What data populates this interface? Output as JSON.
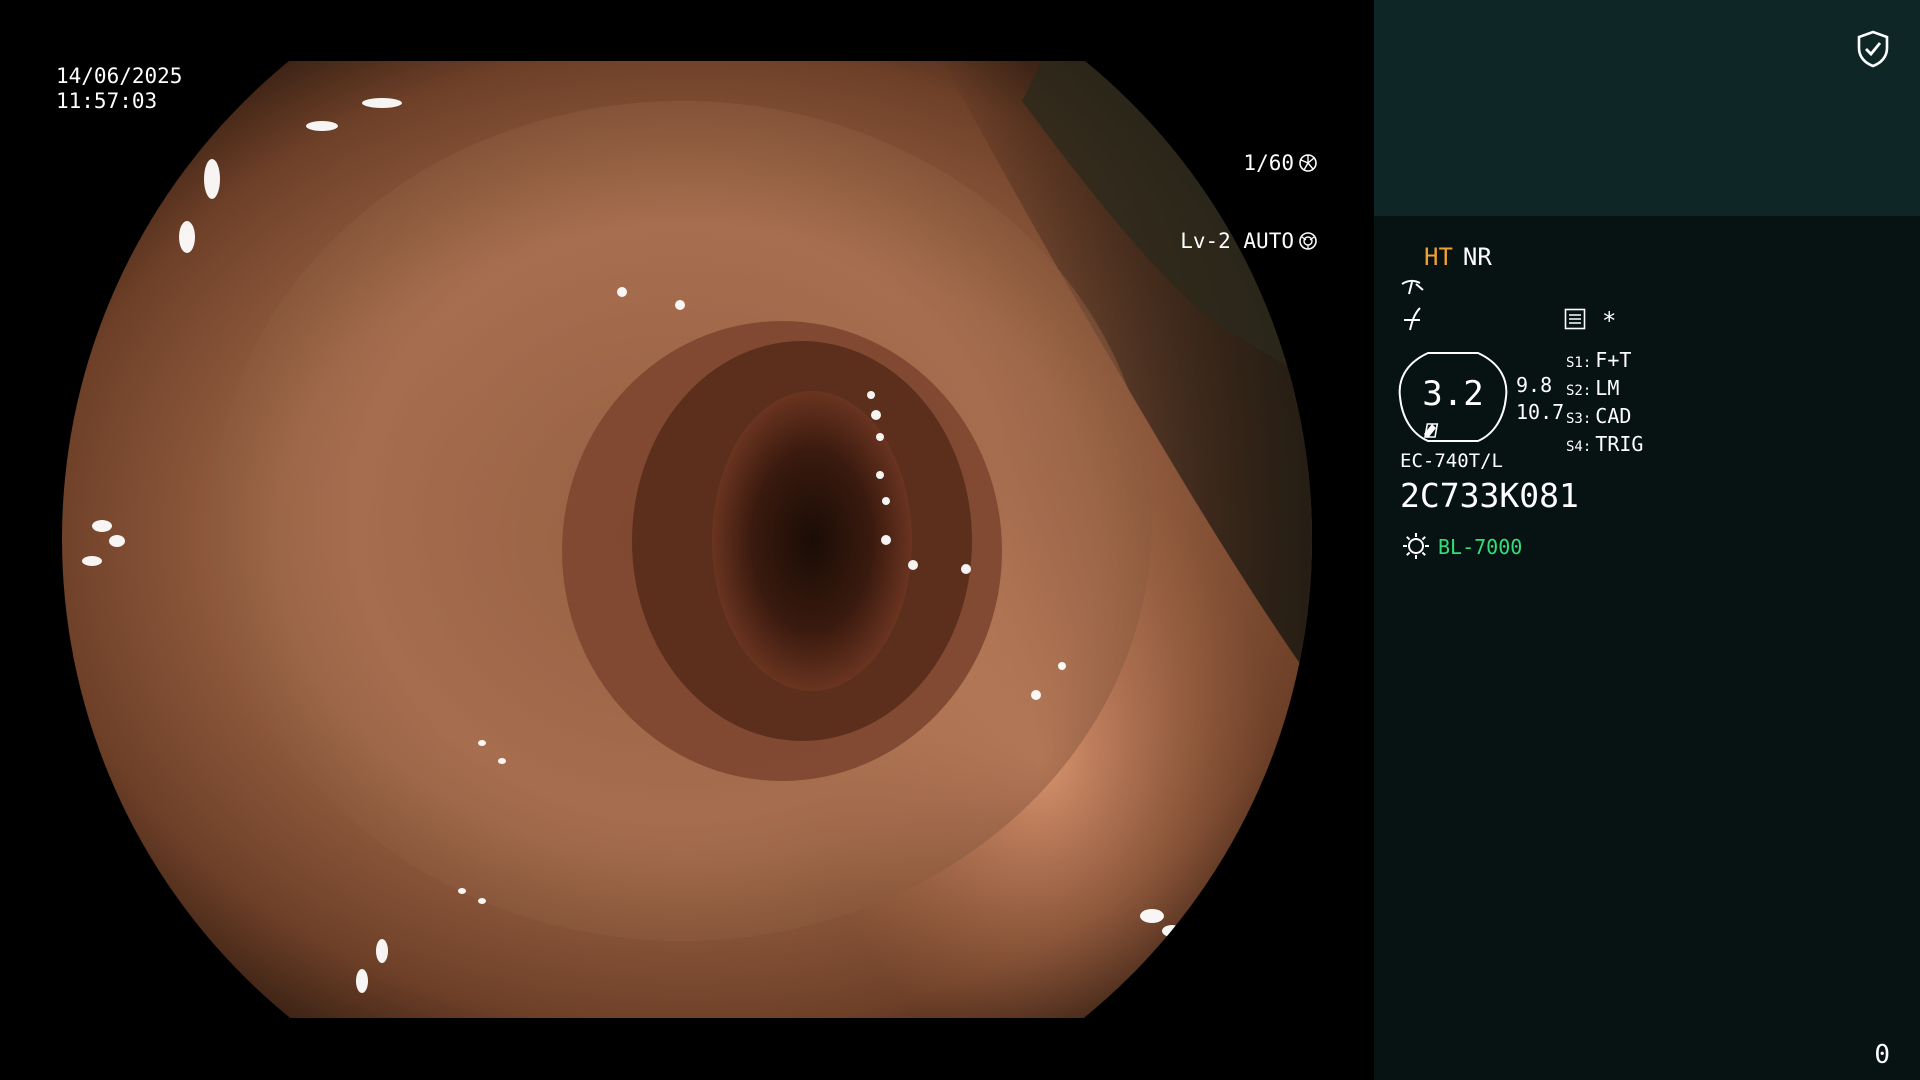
{
  "overlay": {
    "date": "14/06/2025",
    "time": "11:57:03",
    "shutter": "1/60",
    "level_mode": "Lv-2 AUTO"
  },
  "panel": {
    "mode_ht": "HT",
    "mode_nr": "NR",
    "asterisk": "*",
    "zoom": {
      "value": "3.2",
      "side_top": "9.8",
      "side_bottom": "10.7"
    },
    "switches": [
      {
        "key": "S1:",
        "value": "F+T"
      },
      {
        "key": "S2:",
        "value": "LM"
      },
      {
        "key": "S3:",
        "value": "CAD"
      },
      {
        "key": "S4:",
        "value": "TRIG"
      }
    ],
    "scope_model": "EC-740T/L",
    "scope_serial": "2C733K081",
    "light_source": "BL-7000",
    "counter": "0"
  },
  "colors": {
    "ht_accent": "#f0a030",
    "light_source_green": "#2fe07a",
    "panel_top": "#0e2626",
    "panel_body": "#071212"
  },
  "icons": [
    "shutter-icon",
    "iris-icon",
    "shield-check-icon",
    "menu-list-icon",
    "light-source-icon"
  ]
}
